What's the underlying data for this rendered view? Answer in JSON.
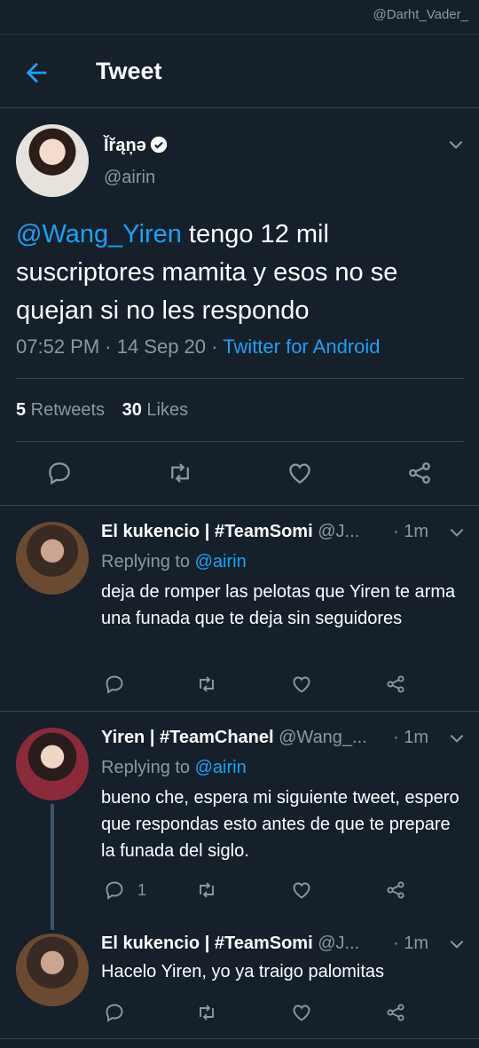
{
  "watermark": "@Darht_Vader_",
  "header": {
    "title": "Tweet"
  },
  "tweet": {
    "name": "Ĭřąņə",
    "handle": "@airin",
    "mention": "@Wang_Yiren",
    "text": " tengo 12 mil suscriptores mamita y esos no se quejan si no les respondo",
    "time": "07:52 PM · 14 Sep 20 · ",
    "source": "Twitter for Android",
    "retweets_count": "5",
    "retweets_label": " Retweets",
    "likes_count": "30",
    "likes_label": " Likes"
  },
  "replies": [
    {
      "name": "El kukencio | #TeamSomi",
      "handle": "@J...",
      "time": "· 1m",
      "replying_label": "Replying to ",
      "replying_to": "@airin",
      "text": "deja de romper las pelotas que Yiren te arma una funada que te deja sin seguidores",
      "reply_count": ""
    },
    {
      "name": "Yiren | #TeamChanel",
      "handle": "@Wang_...",
      "time": "· 1m",
      "replying_label": "Replying to ",
      "replying_to": "@airin",
      "text": "bueno che, espera mi siguiente tweet, espero que respondas esto antes de que te prepare la funada del siglo.",
      "reply_count": "1"
    },
    {
      "name": "El kukencio | #TeamSomi",
      "handle": "@J...",
      "time": "· 1m",
      "text": "Hacelo Yiren, yo ya traigo palomitas",
      "reply_count": ""
    }
  ],
  "colors": {
    "background": "#15202b",
    "accent": "#1da1f2",
    "secondary_text": "#8899a6",
    "divider": "#38444d"
  },
  "icons": [
    "back-arrow-icon",
    "verified-badge-icon",
    "chevron-down-icon",
    "reply-icon",
    "retweet-icon",
    "like-icon",
    "share-icon"
  ]
}
